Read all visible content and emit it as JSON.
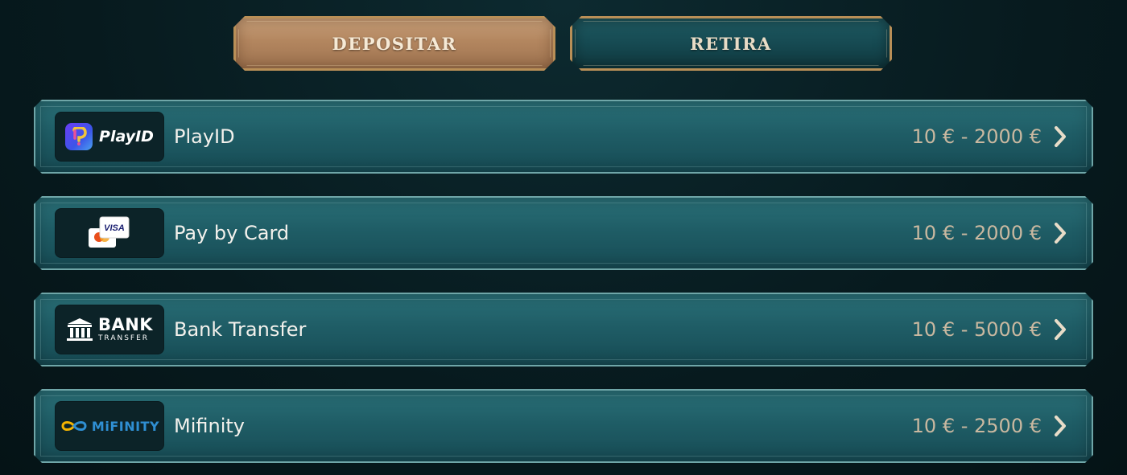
{
  "tabs": {
    "deposit_label": "DEPOSITAR",
    "withdraw_label": "RETIRA",
    "active": "deposit"
  },
  "methods": [
    {
      "name": "PlayID",
      "range": "10 € - 2000 €",
      "logo_icon": "playid-logo",
      "logo_text": "PlayID"
    },
    {
      "name": "Pay by Card",
      "range": "10 € - 2000 €",
      "logo_icon": "visa-card-logo",
      "logo_text": "VISA"
    },
    {
      "name": "Bank Transfer",
      "range": "10 € - 5000 €",
      "logo_icon": "bank-transfer-logo",
      "logo_text": "BANK",
      "logo_subtext": "TRANSFER"
    },
    {
      "name": "Mifinity",
      "range": "10 € - 2500 €",
      "logo_icon": "mifinity-logo",
      "logo_text": "MiFINITY"
    }
  ],
  "colors": {
    "background": "#071a1e",
    "deposit_tab": "#b3865f",
    "withdraw_tab": "#164a52",
    "row": "#1f5d66",
    "range_text": "#c9b8a0"
  }
}
